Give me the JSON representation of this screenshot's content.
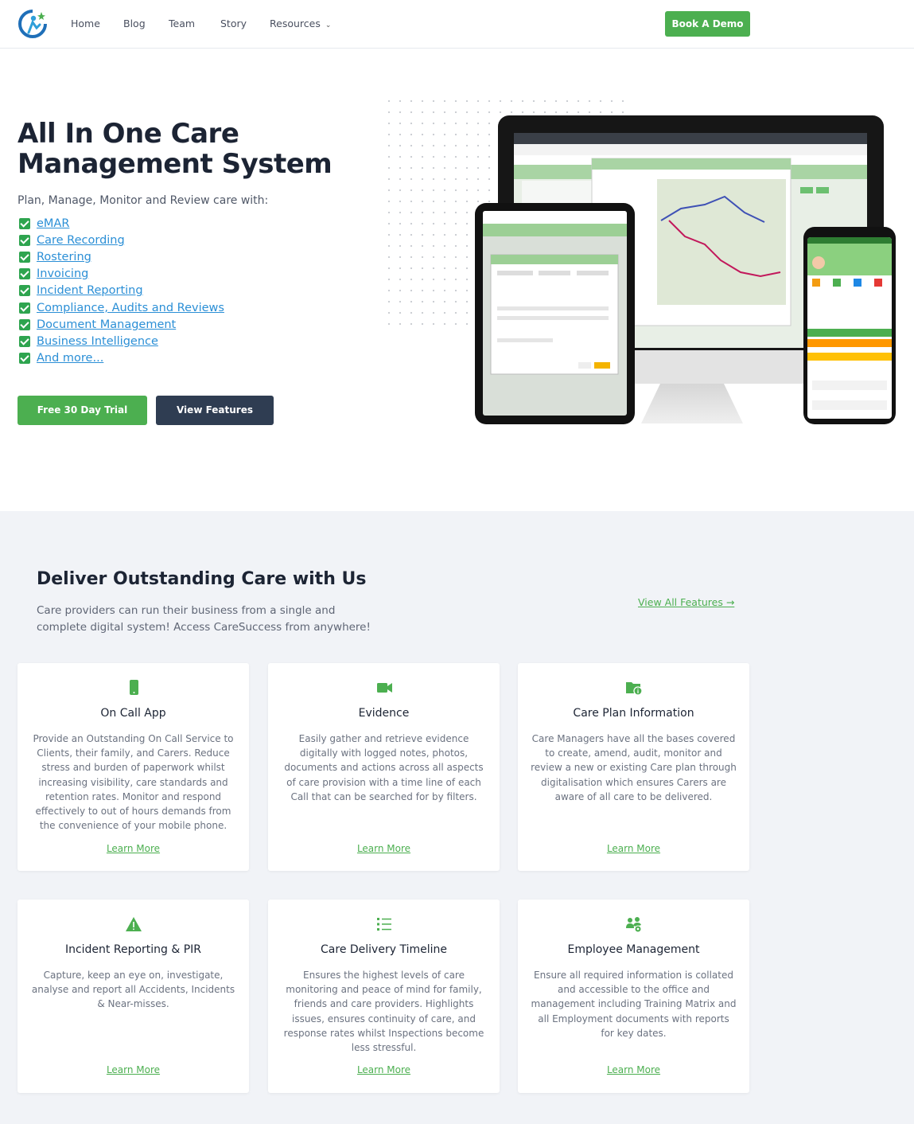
{
  "nav": {
    "logo": "caresuccess-logo-icon",
    "links": [
      "Home",
      "Blog",
      "Team",
      "Story",
      "Resources"
    ],
    "cta": "Book A Demo"
  },
  "hero": {
    "title": "All In One Care Management System",
    "subtitle": "Plan, Manage, Monitor and Review care with:",
    "features": [
      "eMAR",
      "Care Recording",
      "Rostering",
      "Invoicing",
      "Incident Reporting",
      "Compliance, Audits and Reviews",
      "Document Management",
      "Business Intelligence",
      "And more..."
    ],
    "primary_cta": "Free 30 Day Trial",
    "secondary_cta": "View Features"
  },
  "section": {
    "title": "Deliver Outstanding Care with Us",
    "subtitle": "Care providers can run their business from a single and complete digital system! Access CareSuccess from anywhere!",
    "view_all": "View All Features →"
  },
  "cards": [
    {
      "icon": "mobile-phone-icon",
      "title": "On Call App",
      "desc": "Provide an Outstanding On Call Service to Clients, their family, and Carers. Reduce stress and burden of paperwork whilst increasing visibility, care standards and retention rates. Monitor and respond effectively to out of hours demands from the convenience of your mobile phone.",
      "link": "Learn More"
    },
    {
      "icon": "video-camera-icon",
      "title": "Evidence",
      "desc": "Easily gather and retrieve evidence digitally with logged notes, photos, documents and actions across all aspects of care provision with a time line of each Call that can be searched for by filters.",
      "link": "Learn More"
    },
    {
      "icon": "folder-info-icon",
      "title": "Care Plan Information",
      "desc": "Care Managers have all the bases covered to create, amend, audit, monitor and review a new or existing Care plan through digitalisation which ensures Carers are aware of all care to be delivered.",
      "link": "Learn More"
    },
    {
      "icon": "warning-triangle-icon",
      "title": "Incident Reporting & PIR",
      "desc": "Capture, keep an eye on, investigate, analyse and report all Accidents, Incidents & Near-misses.",
      "link": "Learn More"
    },
    {
      "icon": "list-icon",
      "title": "Care Delivery Timeline",
      "desc": "Ensures the highest levels of care monitoring and peace of mind for family, friends and care providers. Highlights issues, ensures continuity of care, and response rates whilst Inspections become less stressful.",
      "link": "Learn More"
    },
    {
      "icon": "users-cog-icon",
      "title": "Employee Management",
      "desc": "Ensure all required information is collated and accessible to the office and management including Training Matrix and all Employment documents with reports for key dates.",
      "link": "Learn More"
    }
  ],
  "colors": {
    "accent": "#4caf50",
    "dark": "#2f3d52",
    "link": "#2b8fd6",
    "section_bg": "#f1f3f7"
  }
}
